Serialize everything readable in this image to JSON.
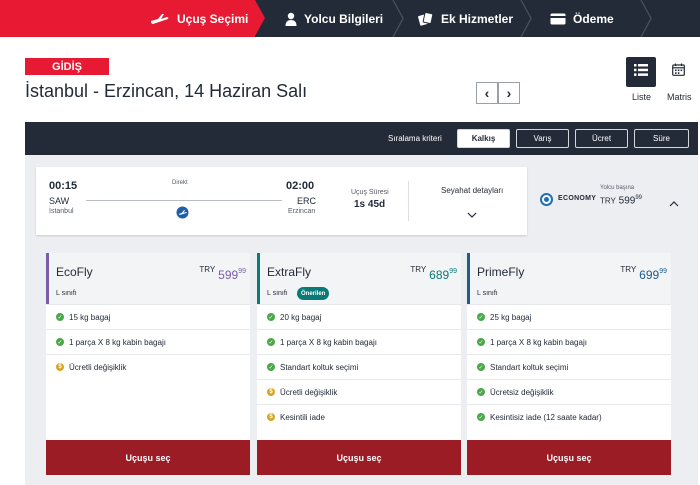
{
  "steps": [
    {
      "label": "Uçuş Seçimi",
      "icon": "plane-icon"
    },
    {
      "label": "Yolcu Bilgileri",
      "icon": "person-icon"
    },
    {
      "label": "Ek Hizmetler",
      "icon": "tickets-icon"
    },
    {
      "label": "Ödeme",
      "icon": "credit-card-icon"
    }
  ],
  "header": {
    "badge": "GİDİŞ",
    "title": "İstanbul - Erzincan, 14 Haziran Salı",
    "prev": "‹",
    "next": "›"
  },
  "views": {
    "list_label": "Liste",
    "matrix_label": "Matris"
  },
  "sort": {
    "label": "Sıralama kriteri",
    "options": [
      "Kalkış",
      "Varış",
      "Ücret",
      "Süre"
    ]
  },
  "flight": {
    "dep_time": "00:15",
    "dep_code": "SAW",
    "dep_city": "İstanbul",
    "arr_time": "02:00",
    "arr_code": "ERC",
    "arr_city": "Erzincan",
    "stop_type": "Direkt",
    "duration_label": "Uçuş Süresi",
    "duration": "1s 45d",
    "details_label": "Seyahat detayları"
  },
  "economy": {
    "label": "ECONOMY",
    "per_person": "Yolcu başına",
    "currency": "TRY",
    "price": "599",
    "price_dec": "99"
  },
  "fares": [
    {
      "name": "EcoFly",
      "class": "L sınıfı",
      "currency": "TRY",
      "price": "599",
      "price_dec": "99",
      "color": "#7b5ca6",
      "features": [
        {
          "text": "15 kg bagaj",
          "icon": "check"
        },
        {
          "text": "1 parça X 8 kg kabin bagajı",
          "icon": "check"
        },
        {
          "text": "Ücretli değişiklik",
          "icon": "money"
        }
      ],
      "button": "Uçuşu seç"
    },
    {
      "name": "ExtraFly",
      "class": "L sınıfı",
      "badge": "Önerilen",
      "currency": "TRY",
      "price": "689",
      "price_dec": "99",
      "color": "#0a7a78",
      "features": [
        {
          "text": "20 kg bagaj",
          "icon": "check"
        },
        {
          "text": "1 parça X 8 kg kabin bagajı",
          "icon": "check"
        },
        {
          "text": "Standart koltuk seçimi",
          "icon": "check"
        },
        {
          "text": "Ücretli değişiklik",
          "icon": "money"
        },
        {
          "text": "Kesintili iade",
          "icon": "money"
        }
      ],
      "button": "Uçuşu seç"
    },
    {
      "name": "PrimeFly",
      "class": "L sınıfı",
      "currency": "TRY",
      "price": "699",
      "price_dec": "99",
      "color": "#1d5d8a",
      "features": [
        {
          "text": "25 kg bagaj",
          "icon": "check"
        },
        {
          "text": "1 parça X 8 kg kabin bagajı",
          "icon": "check"
        },
        {
          "text": "Standart koltuk seçimi",
          "icon": "check"
        },
        {
          "text": "Ücretsiz değişiklik",
          "icon": "check"
        },
        {
          "text": "Kesintisiz iade (12 saate kadar)",
          "icon": "check"
        }
      ],
      "button": "Uçuşu seç"
    }
  ],
  "colors": {
    "brand_red": "#e81932",
    "dark_navy": "#232b38",
    "select_button": "#9b1c25"
  }
}
